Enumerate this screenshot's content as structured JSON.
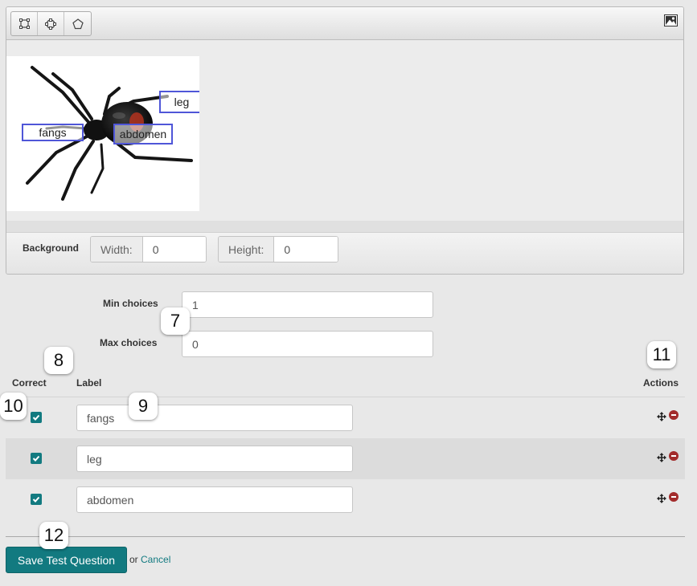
{
  "toolbar": {
    "tools": [
      {
        "name": "rectangle-tool",
        "icon": "rectangle-icon"
      },
      {
        "name": "circle-tool",
        "icon": "circle-icon"
      },
      {
        "name": "polygon-tool",
        "icon": "polygon-icon"
      }
    ],
    "image_icon": "image-icon"
  },
  "canvas": {
    "image_subject": "spider-image",
    "hotspots": [
      {
        "label": "leg"
      },
      {
        "label": "fangs"
      },
      {
        "label": "abdomen"
      }
    ]
  },
  "background": {
    "label": "Background",
    "width_label": "Width:",
    "width_value": "0",
    "height_label": "Height:",
    "height_value": "0"
  },
  "settings": {
    "min_label": "Min choices",
    "min_value": "1",
    "max_label": "Max choices",
    "max_value": "0"
  },
  "table": {
    "correct_header": "Correct",
    "label_header": "Label",
    "actions_header": "Actions",
    "rows": [
      {
        "label": "fangs",
        "correct": true
      },
      {
        "label": "leg",
        "correct": true
      },
      {
        "label": "abdomen",
        "correct": true
      }
    ]
  },
  "callouts": [
    "7",
    "8",
    "9",
    "10",
    "11",
    "12"
  ],
  "footer": {
    "save_label": "Save Test Question",
    "or_text": "or",
    "cancel_label": "Cancel"
  },
  "colors": {
    "accent": "#127a80",
    "hotspot_border": "#4f56d8",
    "remove": "#a22b2b"
  }
}
